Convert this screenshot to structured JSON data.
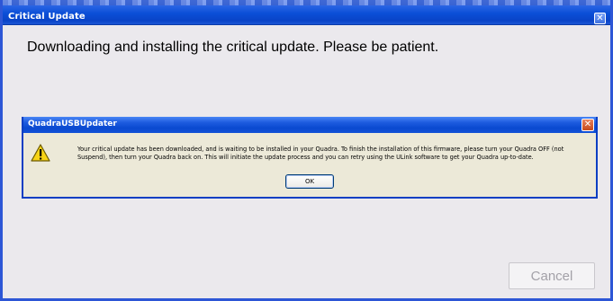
{
  "window": {
    "title": "Critical Update",
    "close_glyph": "✕",
    "message": "Downloading and installing the critical update.  Please be patient.",
    "cancel_label": "Cancel"
  },
  "dialog": {
    "title": "QuadraUSBUpdater",
    "close_glyph": "✕",
    "icon": "warning-icon",
    "message_line1": "Your critical update has been downloaded, and is waiting to be installed in your Quadra.  To finish the installation of this firmware, please turn your Quadra OFF (not",
    "message_line2": "Suspend), then turn your Quadra back on.  This will initiate the update process and you can retry using the ULink software to get your Quadra up-to-date.",
    "ok_label": "OK"
  },
  "colors": {
    "titlebar": "#0b4fd7",
    "dialog_background": "#ece9d8",
    "window_background": "#ebe9ed",
    "dialog_close": "#c64a1c",
    "warning": "#f7d417"
  }
}
